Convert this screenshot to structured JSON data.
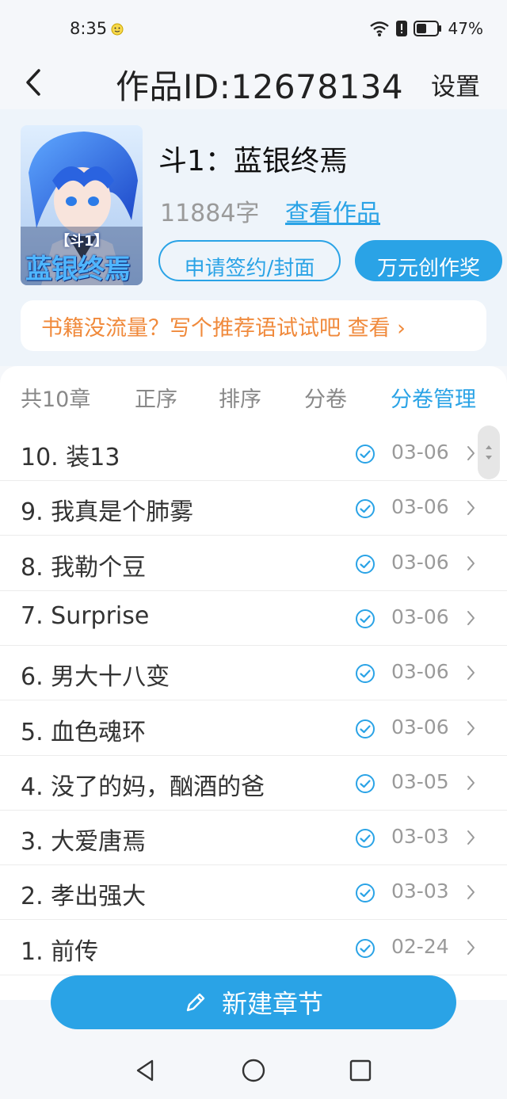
{
  "status_bar": {
    "time": "8:35",
    "battery_pct": "47%"
  },
  "nav": {
    "back_icon": "chevron-left-icon",
    "title": "作品ID:12678134",
    "settings_label": "设置"
  },
  "book": {
    "cover_title_top": "【斗1】",
    "cover_title_main": "蓝银终焉",
    "title": "斗1：蓝银终焉",
    "word_count": "11884字",
    "view_label": "查看作品",
    "apply_label": "申请签约/封面",
    "award_label": "万元创作奖"
  },
  "promo": {
    "text": "书籍没流量？写个推荐语试试吧 查看 ›"
  },
  "toolbar": {
    "total": "共10章",
    "order": "正序",
    "sort": "排序",
    "volume": "分卷",
    "volume_manage": "分卷管理"
  },
  "chapters": [
    {
      "title": "10. 装13",
      "date": "03-06"
    },
    {
      "title": "9. 我真是个肺雾",
      "date": "03-06"
    },
    {
      "title": "8. 我勒个豆",
      "date": "03-06"
    },
    {
      "title": "7. Surprise",
      "date": "03-06"
    },
    {
      "title": "6. 男大十八变",
      "date": "03-06"
    },
    {
      "title": "5. 血色魂环",
      "date": "03-06"
    },
    {
      "title": "4. 没了的妈，酗酒的爸",
      "date": "03-05"
    },
    {
      "title": "3. 大爱唐焉",
      "date": "03-03"
    },
    {
      "title": "2. 孝出强大",
      "date": "03-03"
    },
    {
      "title": "1. 前传",
      "date": "02-24"
    }
  ],
  "new_chapter": {
    "label": "新建章节",
    "icon": "pencil-icon"
  },
  "colors": {
    "accent": "#2aa3e6",
    "promo": "#f08a3c"
  }
}
